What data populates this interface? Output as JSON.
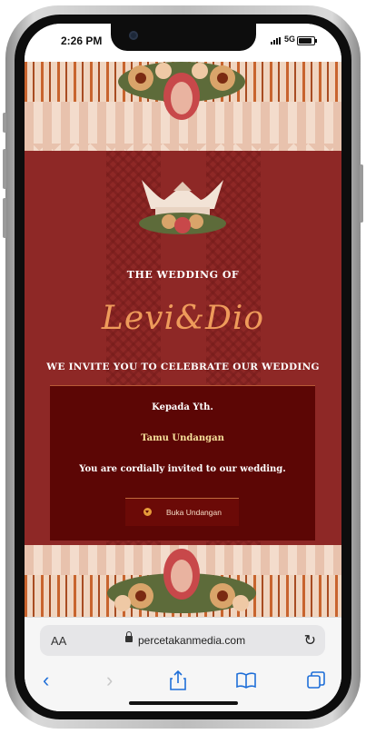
{
  "status": {
    "time": "2:26 PM",
    "network": "5G"
  },
  "invitation": {
    "heading": "THE WEDDING OF",
    "names": "Levi&Dio",
    "invite_line": "WE INVITE YOU TO CELEBRATE OUR WEDDING",
    "card": {
      "to_label": "Kepada Yth.",
      "guest": "Tamu Undangan",
      "message": "You are cordially invited to our wedding.",
      "open_button": "Buka Undangan"
    },
    "colors": {
      "background": "#8e2826",
      "card": "#5c0605",
      "accent": "#ee9b5b"
    }
  },
  "browser": {
    "aa_label": "AA",
    "url": "percetakanmedia.com",
    "icons": [
      "back-icon",
      "forward-icon",
      "share-icon",
      "bookmarks-icon",
      "tabs-icon",
      "reload-icon",
      "lock-icon"
    ]
  }
}
